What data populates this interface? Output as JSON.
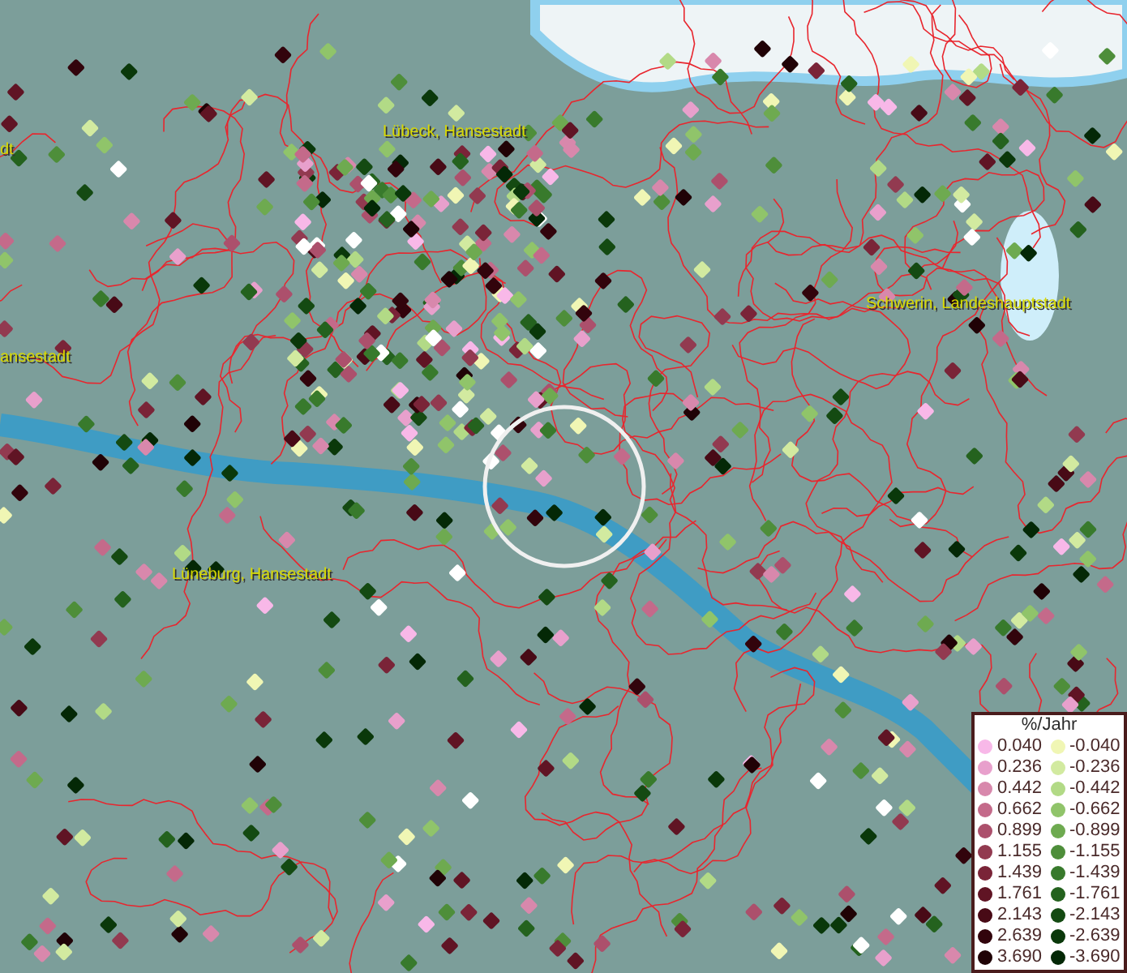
{
  "map": {
    "place_labels": [
      "dt",
      "Lübeck, Hansestadt",
      "Schwerin, Landeshauptstadt",
      "ansestadt",
      "Lüneburg, Hansestadt"
    ]
  },
  "legend": {
    "title": "%/Jahr",
    "entries": [
      {
        "label": "0.040",
        "color": "#f8b8e8"
      },
      {
        "label": "0.236",
        "color": "#e8a0cc"
      },
      {
        "label": "0.442",
        "color": "#d888ac"
      },
      {
        "label": "0.662",
        "color": "#c46a8a"
      },
      {
        "label": "0.899",
        "color": "#ac506c"
      },
      {
        "label": "1.155",
        "color": "#923a50"
      },
      {
        "label": "1.439",
        "color": "#7a2438"
      },
      {
        "label": "1.761",
        "color": "#601424"
      },
      {
        "label": "2.143",
        "color": "#480a16"
      },
      {
        "label": "2.639",
        "color": "#32040c"
      },
      {
        "label": "3.690",
        "color": "#200206"
      },
      {
        "label": "-0.040",
        "color": "#f0f6b4"
      },
      {
        "label": "-0.236",
        "color": "#d2eaa0"
      },
      {
        "label": "-0.442",
        "color": "#b2da86"
      },
      {
        "label": "-0.662",
        "color": "#90c46a"
      },
      {
        "label": "-0.899",
        "color": "#6eaa50"
      },
      {
        "label": "-1.155",
        "color": "#4e8e3a"
      },
      {
        "label": "-1.439",
        "color": "#387a2c"
      },
      {
        "label": "-1.761",
        "color": "#24621e"
      },
      {
        "label": "-2.143",
        "color": "#144a12"
      },
      {
        "label": "-2.639",
        "color": "#0a380a"
      },
      {
        "label": "-3.690",
        "color": "#042806"
      }
    ]
  }
}
